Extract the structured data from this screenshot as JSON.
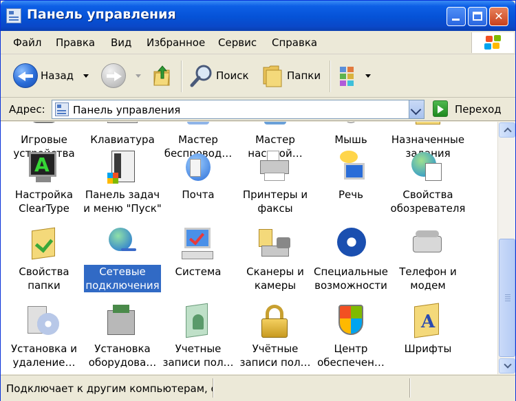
{
  "window": {
    "title": "Панель управления"
  },
  "menu": [
    "Файл",
    "Правка",
    "Вид",
    "Избранное",
    "Сервис",
    "Справка"
  ],
  "toolbar": {
    "back_label": "Назад",
    "search_label": "Поиск",
    "folders_label": "Папки"
  },
  "address": {
    "label": "Адрес:",
    "value": "Панель управления",
    "go_label": "Переход"
  },
  "items": [
    {
      "label": "Игровые\nустройства",
      "icon": "game-controllers-icon"
    },
    {
      "label": "Клавиатура",
      "icon": "keyboard-icon"
    },
    {
      "label": "Мастер\nбеспровод…",
      "icon": "wireless-wizard-icon"
    },
    {
      "label": "Мастер\nнастрой…",
      "icon": "network-setup-wizard-icon"
    },
    {
      "label": "Мышь",
      "icon": "mouse-icon"
    },
    {
      "label": "Назначенные\nзадания",
      "icon": "scheduled-tasks-icon"
    },
    {
      "label": "Настройка\nClearType",
      "icon": "cleartype-icon"
    },
    {
      "label": "Панель задач\nи меню \"Пуск\"",
      "icon": "taskbar-icon"
    },
    {
      "label": "Почта",
      "icon": "mail-icon"
    },
    {
      "label": "Принтеры и\nфаксы",
      "icon": "printers-icon"
    },
    {
      "label": "Речь",
      "icon": "speech-icon"
    },
    {
      "label": "Свойства\nобозревателя",
      "icon": "internet-options-icon"
    },
    {
      "label": "Свойства\nпапки",
      "icon": "folder-options-icon"
    },
    {
      "label": "Сетевые\nподключения",
      "icon": "network-connections-icon",
      "selected": true
    },
    {
      "label": "Система",
      "icon": "system-icon"
    },
    {
      "label": "Сканеры и\nкамеры",
      "icon": "scanners-cameras-icon"
    },
    {
      "label": "Специальные\nвозможности",
      "icon": "accessibility-icon"
    },
    {
      "label": "Телефон и\nмодем",
      "icon": "phone-modem-icon"
    },
    {
      "label": "Установка и\nудаление…",
      "icon": "add-remove-programs-icon"
    },
    {
      "label": "Установка\nоборудова…",
      "icon": "add-hardware-icon"
    },
    {
      "label": "Учетные\nзаписи пол…",
      "icon": "user-accounts-icon"
    },
    {
      "label": "Учётные\nзаписи пол…",
      "icon": "user-accounts-lock-icon"
    },
    {
      "label": "Центр\nобеспечен…",
      "icon": "security-center-icon"
    },
    {
      "label": "Шрифты",
      "icon": "fonts-icon"
    }
  ],
  "status": {
    "text": "Подключает к другим компьютерам, се"
  },
  "colors": {
    "title_bar": "#0552d6",
    "selection": "#316ac5",
    "face": "#ece9d8"
  }
}
